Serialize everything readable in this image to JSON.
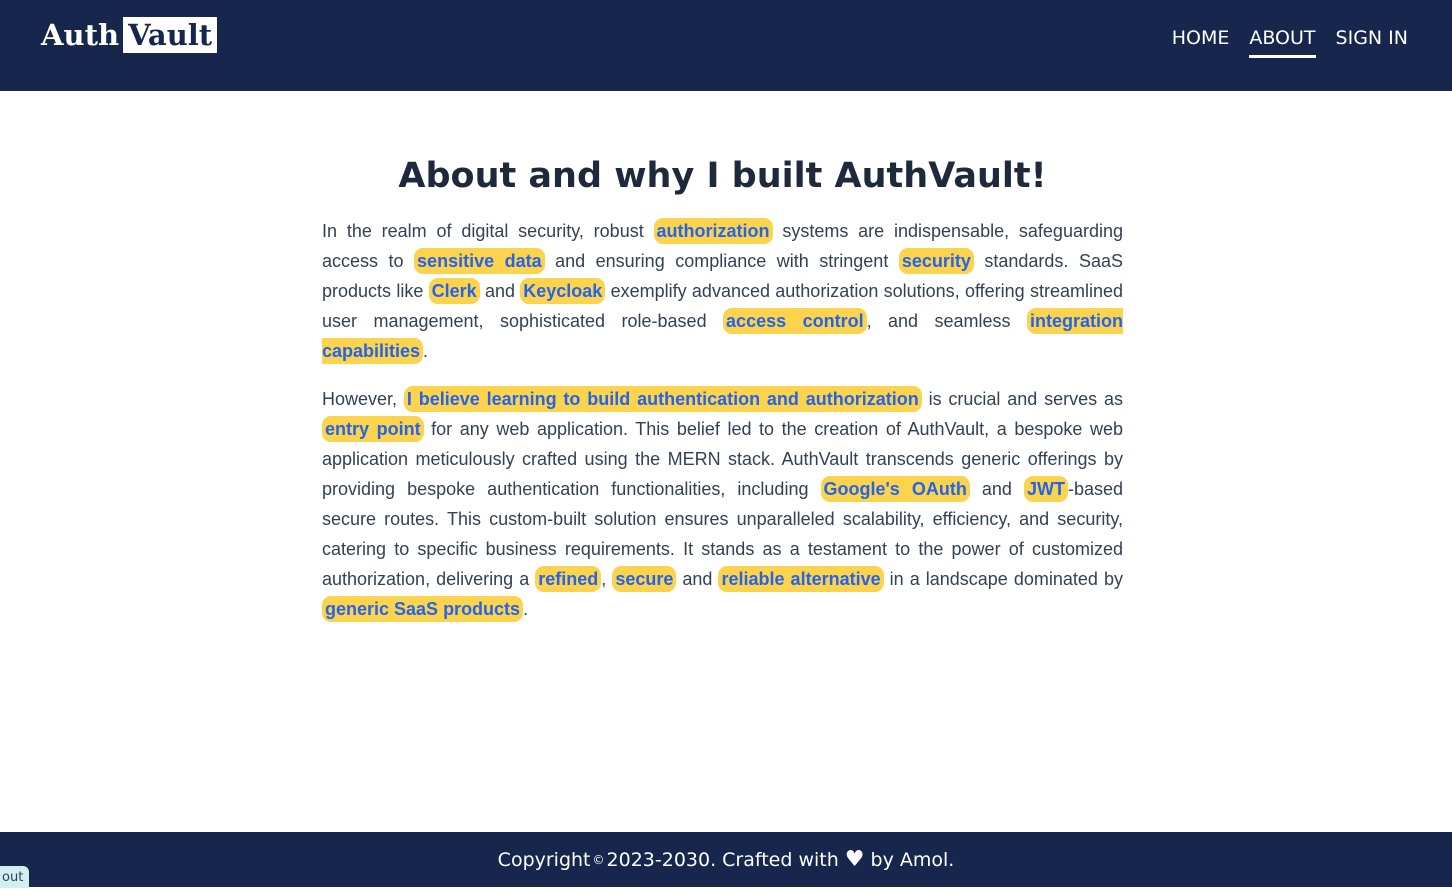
{
  "header": {
    "logo_part1": "Auth",
    "logo_part2": "Vault",
    "nav": [
      "HOME",
      "ABOUT",
      "SIGN IN"
    ]
  },
  "main": {
    "title": "About and why I built AuthVault!",
    "p1": [
      "In the realm of digital security, robust ",
      "authorization",
      " systems are indispensable, safeguarding access to ",
      "sensitive data",
      " and ensuring compliance with stringent ",
      "security",
      " standards. SaaS products like ",
      "Clerk",
      " and ",
      "Keycloak",
      " exemplify advanced authorization solutions, offering streamlined user management, sophisticated role-based ",
      "access control",
      ", and seamless ",
      "integration capabilities",
      "."
    ],
    "p2": [
      "However, ",
      "I believe learning to build authentication and authorization",
      " is crucial and serves as ",
      "entry point",
      " for any web application. This belief led to the creation of AuthVault, a bespoke web application meticulously crafted using the MERN stack. AuthVault transcends generic offerings by providing bespoke authentication functionalities, including ",
      "Google's OAuth",
      " and ",
      "JWT",
      "-based secure routes. This custom-built solution ensures unparalleled scalability, efficiency, and security, catering to specific business requirements. It stands as a testament to the power of customized authorization, delivering a ",
      "refined",
      ", ",
      "secure",
      " and ",
      "reliable alternative",
      " in a landscape dominated by ",
      "generic SaaS products",
      "."
    ]
  },
  "footer": {
    "text_before": "Copyright",
    "copyright_symbol": "©",
    "text_middle": "2023-2030. Crafted with",
    "heart_icon": "heart-icon",
    "text_after": "by Amol."
  },
  "corner_tab": "out",
  "colors": {
    "nav_bg": "#16264d",
    "highlight_bg": "#fcd34d",
    "highlight_text": "#2563eb"
  }
}
